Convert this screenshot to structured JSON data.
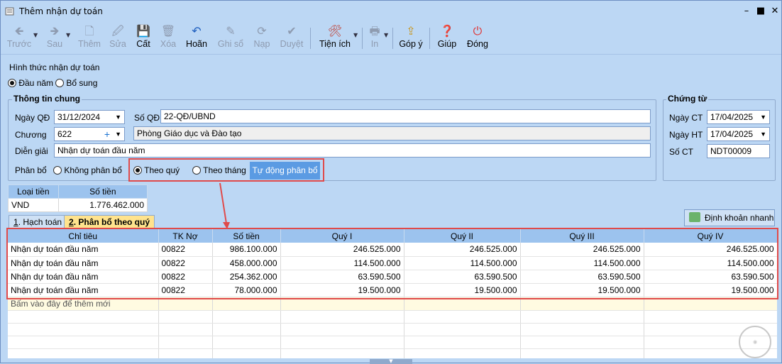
{
  "window": {
    "title": "Thêm nhận dự toán"
  },
  "toolbar": {
    "back": "Trước",
    "forward": "Sau",
    "add": "Thêm",
    "edit": "Sửa",
    "save": "Cất",
    "delete": "Xóa",
    "undo": "Hoãn",
    "post": "Ghi sổ",
    "reload": "Nạp",
    "approve": "Duyệt",
    "utilities": "Tiện ích",
    "print": "In",
    "feedback": "Góp ý",
    "help": "Giúp",
    "close": "Đóng"
  },
  "receive_type": {
    "label": "Hình thức nhận dự toán",
    "options": [
      "Đầu năm",
      "Bổ sung"
    ],
    "selected": "Đầu năm"
  },
  "general": {
    "title": "Thông tin chung",
    "date_label": "Ngày QĐ",
    "date_value": "31/12/2024",
    "decision_label": "Số QĐ",
    "decision_value": "22-QĐ/UBND",
    "chapter_label": "Chương",
    "chapter_value": "622",
    "chapter_name": "Phòng Giáo dục và Đào tạo",
    "desc_label": "Diễn giải",
    "desc_value": "Nhận dự toán đầu năm",
    "alloc_label": "Phân bổ",
    "alloc_none": "Không phân bổ",
    "alloc_quarter": "Theo quý",
    "alloc_month": "Theo tháng",
    "auto_alloc": "Tự động phân bổ"
  },
  "voucher": {
    "title": "Chứng từ",
    "ct_date_label": "Ngày CT",
    "ct_date_value": "17/04/2025",
    "ht_date_label": "Ngày HT",
    "ht_date_value": "17/04/2025",
    "no_label": "Số CT",
    "no_value": "NDT00009"
  },
  "currency": {
    "headers": [
      "Loại tiền",
      "Số tiền"
    ],
    "row": [
      "VND",
      "1.776.462.000"
    ]
  },
  "tabs": {
    "tab1_num": "1",
    "tab1": ". Hạch toán",
    "tab2_num": "2",
    "tab2": ". Phân bổ theo quý"
  },
  "quick_entry": "Định khoản nhanh",
  "grid": {
    "headers": [
      "Chỉ tiêu",
      "TK Nợ",
      "Số tiền",
      "Quý I",
      "Quý II",
      "Quý III",
      "Quý IV"
    ],
    "rows": [
      [
        "Nhận dự toán đầu năm",
        "00822",
        "986.100.000",
        "246.525.000",
        "246.525.000",
        "246.525.000",
        "246.525.000"
      ],
      [
        "Nhận dự toán đầu năm",
        "00822",
        "458.000.000",
        "114.500.000",
        "114.500.000",
        "114.500.000",
        "114.500.000"
      ],
      [
        "Nhận dự toán đầu năm",
        "00822",
        "254.362.000",
        "63.590.500",
        "63.590.500",
        "63.590.500",
        "63.590.500"
      ],
      [
        "Nhận dự toán đầu năm",
        "00822",
        "78.000.000",
        "19.500.000",
        "19.500.000",
        "19.500.000",
        "19.500.000"
      ]
    ],
    "add_row": "Bấm vào đây để thêm mới"
  },
  "colors": {
    "background": "#bcd7f4",
    "header": "#9cc3ee",
    "highlight": "#e04a4a",
    "active_tab": "#ffe38d"
  }
}
